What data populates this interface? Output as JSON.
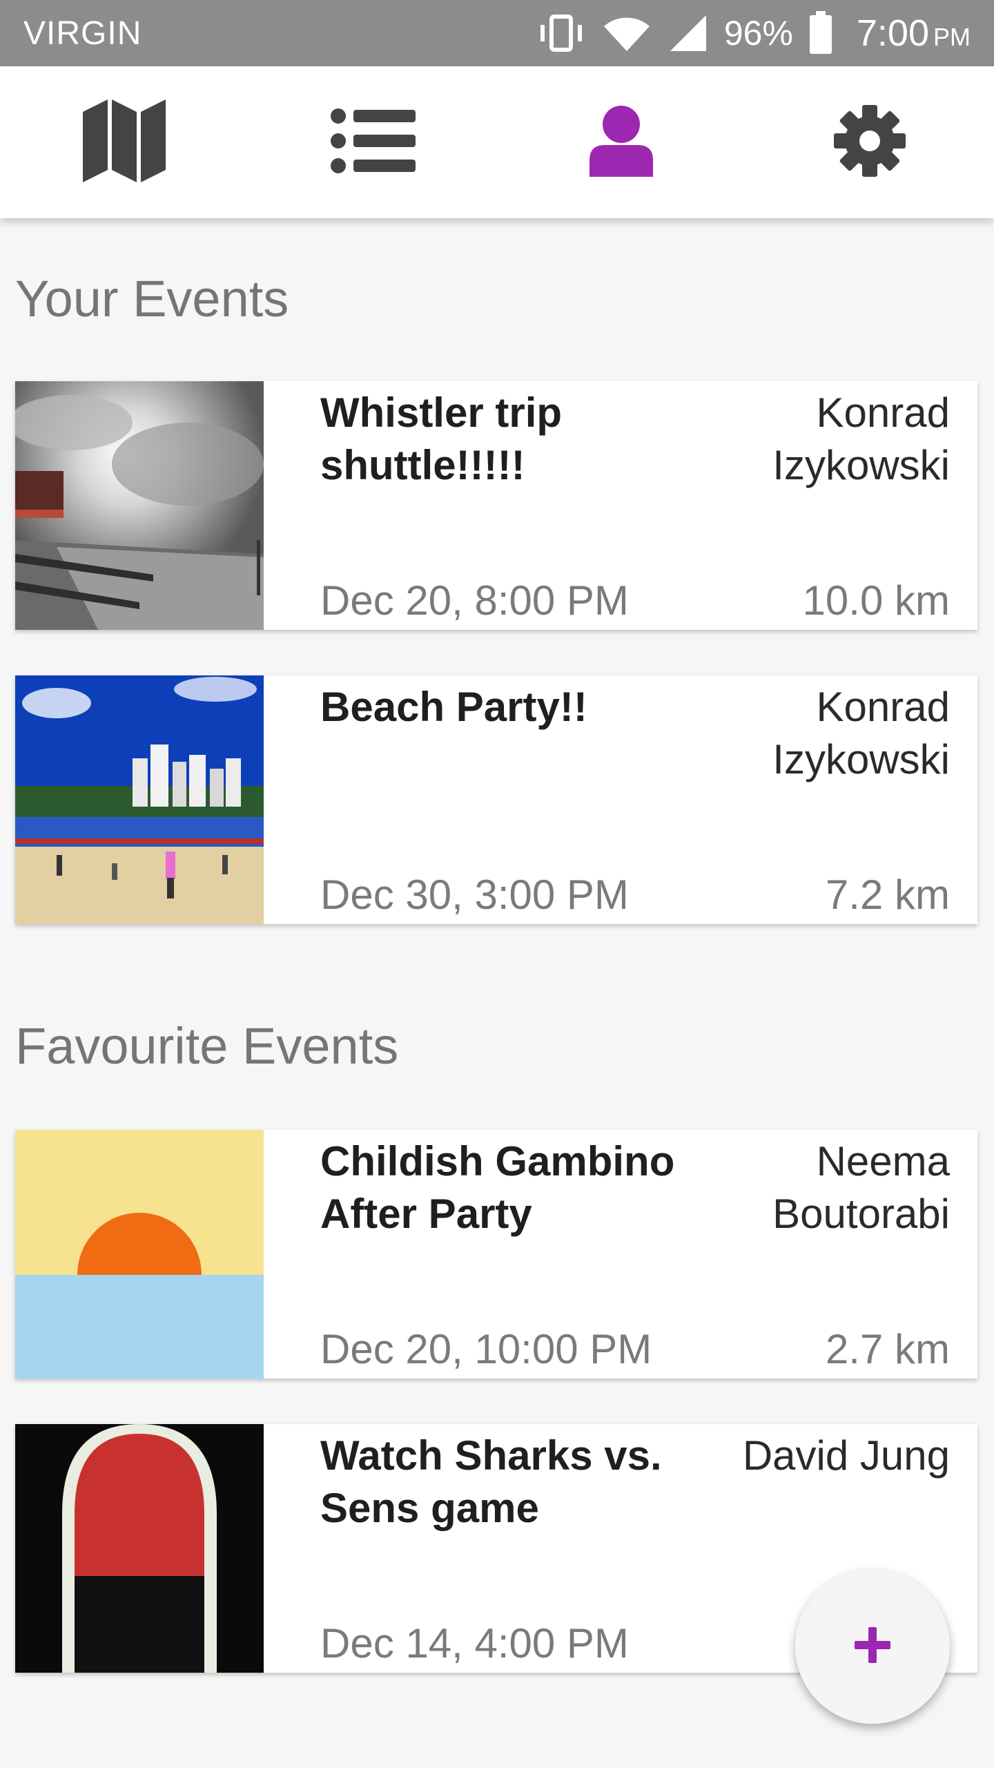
{
  "status_bar": {
    "carrier": "VIRGIN",
    "battery": "96%",
    "time": "7:00",
    "ampm": "PM"
  },
  "nav": {
    "tabs": [
      {
        "icon": "map-icon",
        "active": false
      },
      {
        "icon": "list-icon",
        "active": false
      },
      {
        "icon": "profile-icon",
        "active": true
      },
      {
        "icon": "gear-icon",
        "active": false
      }
    ],
    "active_color": "#9c27b0",
    "inactive_color": "#444444"
  },
  "your_events": {
    "title": "Your Events",
    "items": [
      {
        "title": "Whistler trip shuttle!!!!!",
        "host": "Konrad Izykowski",
        "date": "Dec 20, 8:00 PM",
        "distance": "10.0 km",
        "thumb": "snowy-mountain-photo"
      },
      {
        "title": "Beach Party!!",
        "host": "Konrad Izykowski",
        "date": "Dec 30, 3:00 PM",
        "distance": "7.2 km",
        "thumb": "beach-photo"
      }
    ]
  },
  "favourite_events": {
    "title": "Favourite Events",
    "items": [
      {
        "title": "Childish Gambino After Party",
        "host": "Neema Boutorabi",
        "date": "Dec 20, 10:00 PM",
        "distance": "2.7 km",
        "thumb": "sunset-illustration"
      },
      {
        "title": "Watch Sharks vs. Sens game",
        "host": "David Jung",
        "date": "Dec 14, 4:00 PM",
        "distance": "",
        "thumb": "sens-logo-image"
      }
    ]
  },
  "fab": {
    "label": "+",
    "icon": "plus-icon",
    "color": "#9c27b0"
  }
}
